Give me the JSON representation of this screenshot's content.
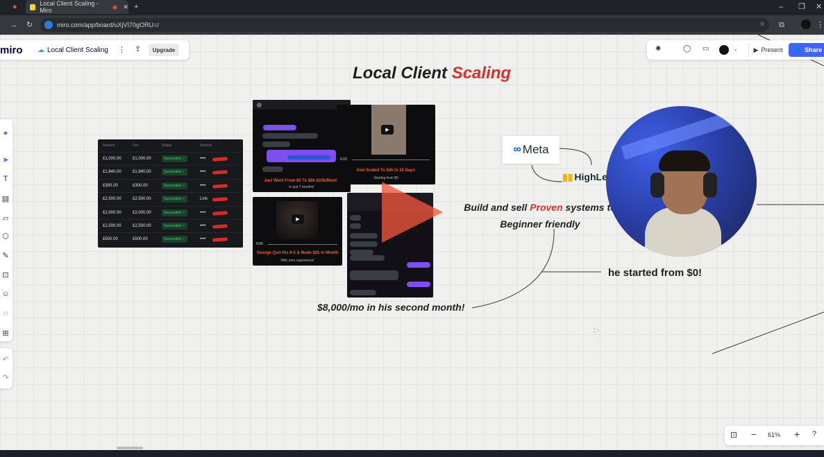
{
  "browser": {
    "tabs": [
      {
        "label": "Local Client Scaling - Miro",
        "active": true
      }
    ],
    "new_tab": "+",
    "url": "miro.com/app/board/uXjVI70gORU=/"
  },
  "miro": {
    "logo": "miro",
    "board_name": "Local Client Scaling",
    "upgrade_label": "Upgrade",
    "present_label": "Present",
    "share_label": "Share",
    "zoom": "61%"
  },
  "board": {
    "title_part1": "Local Client",
    "title_part2": "Scaling",
    "build_part1": "Build and sell",
    "build_accent": "Proven",
    "build_part2": "systems to",
    "build_line2": "Beginner friendly",
    "started_text": "he started from $0!",
    "month_text": "$8,000/mo in his second month!",
    "meta_label": "Meta",
    "highlevel_label": "HighLe"
  },
  "payments": {
    "headers": [
      "Amount",
      "Fee",
      "Status",
      "Method"
    ],
    "rows": [
      {
        "amount": "£1,000.00",
        "fee": "£1,000.00",
        "status": "Succeeded ✓",
        "method": "••••"
      },
      {
        "amount": "£1,840.00",
        "fee": "£1,840.00",
        "status": "Succeeded ✓",
        "method": "••••"
      },
      {
        "amount": "£300.00",
        "fee": "£300.00",
        "status": "Succeeded ✓",
        "method": "••••"
      },
      {
        "amount": "£2,500.00",
        "fee": "£2,500.00",
        "status": "Succeeded ✓",
        "method": "Link"
      },
      {
        "amount": "£2,000.00",
        "fee": "£2,000.00",
        "status": "Succeeded ✓",
        "method": "••••"
      },
      {
        "amount": "£2,500.00",
        "fee": "£2,500.00",
        "status": "Succeeded ✓",
        "method": "••••"
      },
      {
        "amount": "£500.00",
        "fee": "£500.00",
        "status": "Succeeded ✓",
        "method": "••••"
      }
    ]
  },
  "cards": {
    "chat1_caption": "Joel Went From $0 To $8k-$10k/Month",
    "chat1_sub": "in just 7 months!",
    "video1_caption": "Ken Scaled To $4k In 30 Days",
    "video1_sub": "Starting from $0",
    "video2_caption": "George Quit His 9-5 & Made $2k In Month",
    "video2_sub": "With zero experience!",
    "video1_time": "0:22",
    "video2_time": "0:00"
  },
  "colors": {
    "accent_red": "#d6312a",
    "miro_blue": "#4262ff",
    "caption_orange": "#e8601d",
    "succeeded_green": "#45d07b"
  }
}
